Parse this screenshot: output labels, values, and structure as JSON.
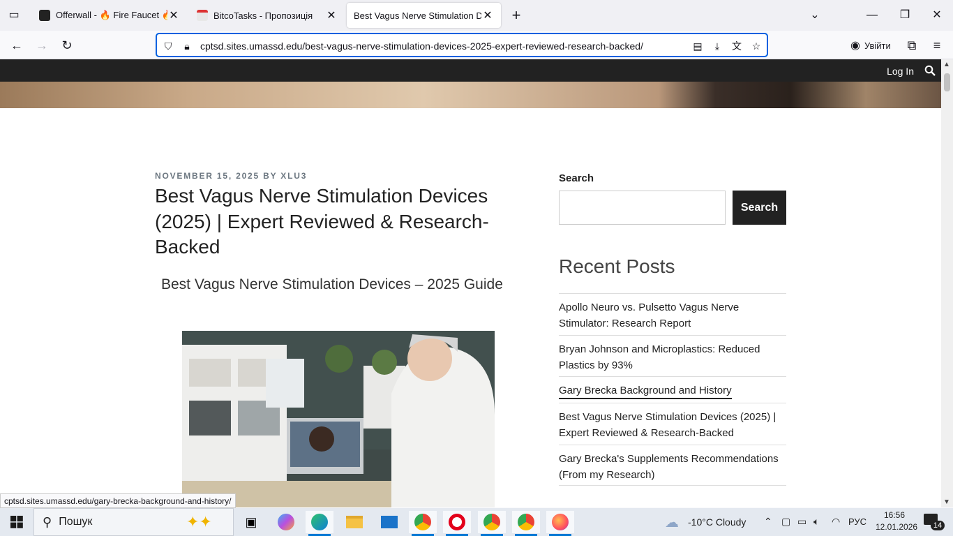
{
  "browser": {
    "tabs": [
      {
        "title": "Offerwall - 🔥 Fire Faucet 🔥",
        "icon": "fire-faucet-favicon",
        "active": false
      },
      {
        "title": "BitcoTasks - Пропозиція",
        "icon": "bitcotasks-favicon",
        "active": false
      },
      {
        "title": "Best Vagus Nerve Stimulation Devic",
        "icon": "",
        "active": true
      }
    ],
    "url": "cptsd.sites.umassd.edu/best-vagus-nerve-stimulation-devices-2025-expert-reviewed-research-backed/",
    "signin_label": "Увійти",
    "status_link": "cptsd.sites.umassd.edu/gary-brecka-background-and-history/"
  },
  "site": {
    "login_label": "Log In"
  },
  "post": {
    "meta": "NOVEMBER 15, 2025 BY XLU3",
    "title": "Best Vagus Nerve Stimulation Devices (2025) | Expert Reviewed & Research-Backed",
    "subheading": "Best Vagus Nerve Stimulation Devices – 2025 Guide"
  },
  "sidebar": {
    "search_label": "Search",
    "search_button": "Search",
    "recent_title": "Recent Posts",
    "recent_posts": [
      "Apollo Neuro vs. Pulsetto Vagus Nerve Stimulator: Research Report",
      "Bryan Johnson and Microplastics: Reduced Plastics by 93%",
      "Gary Brecka Background and History",
      "Best Vagus Nerve Stimulation Devices (2025) | Expert Reviewed & Research-Backed",
      "Gary Brecka's Supplements Recommendations (From my Research)"
    ]
  },
  "taskbar": {
    "search_placeholder": "Пошук",
    "weather": "-10°C  Cloudy",
    "lang": "РУС",
    "time": "16:56",
    "date": "12.01.2026",
    "notifications": "14"
  }
}
